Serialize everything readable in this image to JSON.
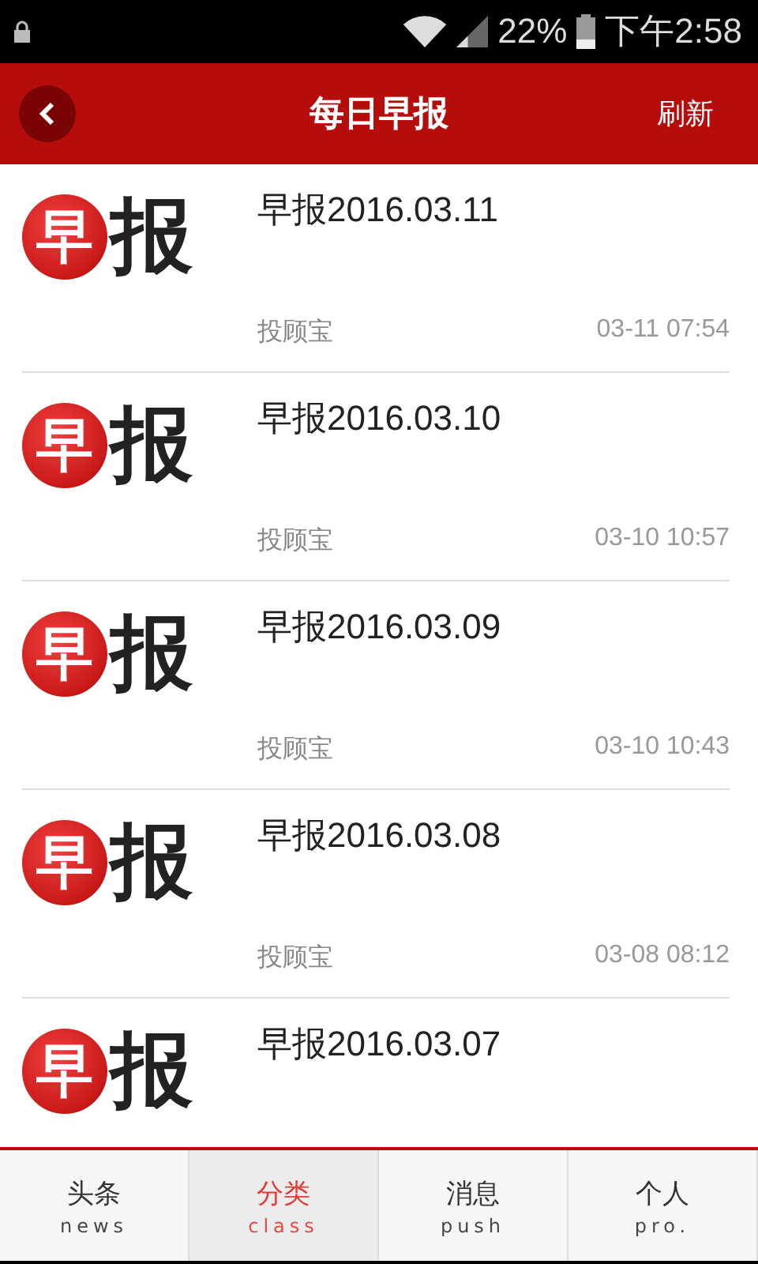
{
  "status_bar": {
    "battery_percent": "22%",
    "time": "下午2:58"
  },
  "header": {
    "title": "每日早报",
    "action": "刷新"
  },
  "items": [
    {
      "logo": [
        "早",
        "报"
      ],
      "title": "早报2016.03.11",
      "source": "投顾宝",
      "time": "03-11 07:54"
    },
    {
      "logo": [
        "早",
        "报"
      ],
      "title": "早报2016.03.10",
      "source": "投顾宝",
      "time": "03-10 10:57"
    },
    {
      "logo": [
        "早",
        "报"
      ],
      "title": "早报2016.03.09",
      "source": "投顾宝",
      "time": "03-10 10:43"
    },
    {
      "logo": [
        "早",
        "报"
      ],
      "title": "早报2016.03.08",
      "source": "投顾宝",
      "time": "03-08 08:12"
    },
    {
      "logo": [
        "早",
        "报"
      ],
      "title": "早报2016.03.07"
    }
  ],
  "tabs": [
    {
      "label": "头条",
      "sub": "news",
      "selected": false
    },
    {
      "label": "分类",
      "sub": "class",
      "selected": true
    },
    {
      "label": "消息",
      "sub": "push",
      "selected": false
    },
    {
      "label": "个人",
      "sub": "pro.",
      "selected": false
    }
  ]
}
